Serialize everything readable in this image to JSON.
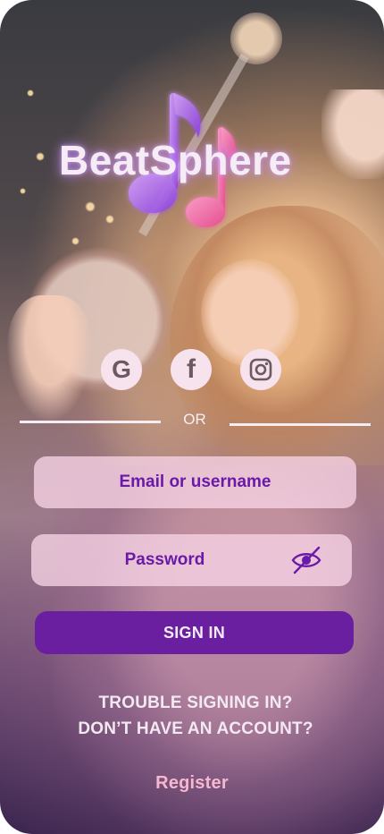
{
  "app": {
    "name": "BeatSphere"
  },
  "social": {
    "google": "G",
    "facebook": "f",
    "instagram": "instagram-icon"
  },
  "divider": {
    "label": "OR"
  },
  "form": {
    "email_placeholder": "Email or username",
    "password_placeholder": "Password",
    "signin_label": "SIGN IN"
  },
  "links": {
    "trouble": "TROUBLE SIGNING IN?",
    "no_account": "DON’T HAVE AN ACCOUNT?",
    "register": "Register"
  },
  "colors": {
    "accent": "#6a1fa0",
    "field_text": "#6a1aa8",
    "field_bg": "#f7d4e6",
    "register_link": "#f6b7cf"
  }
}
